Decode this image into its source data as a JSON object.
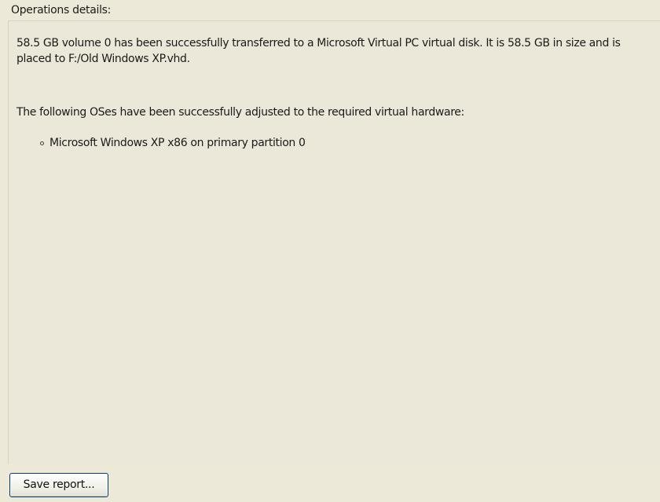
{
  "panel": {
    "title": "Operations details:"
  },
  "report": {
    "transfer_summary": "58.5 GB volume 0 has been successfully transferred to a Microsoft Virtual PC virtual disk. It is 58.5 GB in size and is placed to F:/Old Windows XP.vhd.",
    "adjusted_heading": "The following OSes have been successfully adjusted to the required virtual hardware:",
    "adjusted_os_list": [
      "Microsoft Windows XP x86 on primary partition 0"
    ]
  },
  "actions": {
    "save_report_label": "Save report..."
  }
}
